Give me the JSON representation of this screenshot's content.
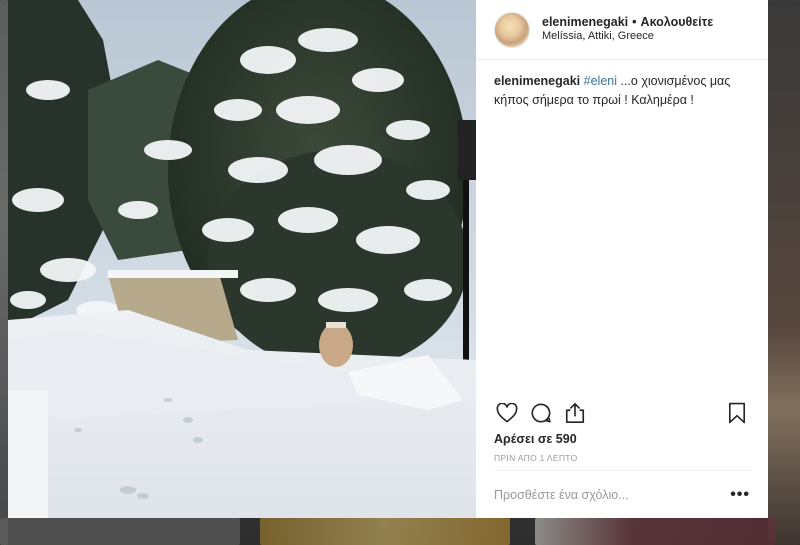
{
  "post": {
    "username": "elenimenegaki",
    "separator": "•",
    "follow_label": "Ακολουθείτε",
    "location": "Melíssia, Attiki, Greece",
    "caption_user": "elenimenegaki",
    "caption_tag": "#eleni",
    "caption_text": " ...ο χιονισμένος μας κήπος σήμερα το πρωί ! Καλημέρα !",
    "likes": "Αρέσει σε 590",
    "time_ago": "ΠΡΙΝ ΑΠΟ 1 ΛΕΠΤΟ",
    "comment_placeholder": "Προσθέστε ένα σχόλιο...",
    "more_label": "•••"
  },
  "icons": {
    "like": "heart-icon",
    "comment": "comment-icon",
    "share": "share-icon",
    "save": "bookmark-icon"
  },
  "colors": {
    "hashtag": "#3f729b",
    "text": "#262626",
    "muted": "#999999"
  }
}
